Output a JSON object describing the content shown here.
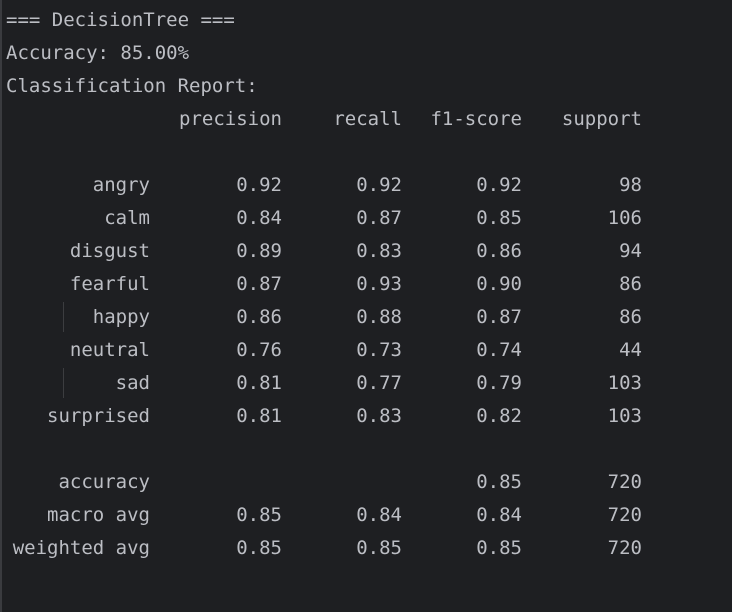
{
  "console": {
    "header": "=== DecisionTree ===",
    "accuracy_line": "Accuracy: 85.00%",
    "report_title": "Classification Report:"
  },
  "report": {
    "headers": [
      "precision",
      "recall",
      "f1-score",
      "support"
    ],
    "rows": [
      {
        "label": "angry",
        "precision": "0.92",
        "recall": "0.92",
        "f1": "0.92",
        "support": "98"
      },
      {
        "label": "calm",
        "precision": "0.84",
        "recall": "0.87",
        "f1": "0.85",
        "support": "106"
      },
      {
        "label": "disgust",
        "precision": "0.89",
        "recall": "0.83",
        "f1": "0.86",
        "support": "94"
      },
      {
        "label": "fearful",
        "precision": "0.87",
        "recall": "0.93",
        "f1": "0.90",
        "support": "86"
      },
      {
        "label": "happy",
        "precision": "0.86",
        "recall": "0.88",
        "f1": "0.87",
        "support": "86"
      },
      {
        "label": "neutral",
        "precision": "0.76",
        "recall": "0.73",
        "f1": "0.74",
        "support": "44"
      },
      {
        "label": "sad",
        "precision": "0.81",
        "recall": "0.77",
        "f1": "0.79",
        "support": "103"
      },
      {
        "label": "surprised",
        "precision": "0.81",
        "recall": "0.83",
        "f1": "0.82",
        "support": "103"
      }
    ],
    "summary": [
      {
        "label": "accuracy",
        "precision": "",
        "recall": "",
        "f1": "0.85",
        "support": "720"
      },
      {
        "label": "macro avg",
        "precision": "0.85",
        "recall": "0.84",
        "f1": "0.84",
        "support": "720"
      },
      {
        "label": "weighted avg",
        "precision": "0.85",
        "recall": "0.85",
        "f1": "0.85",
        "support": "720"
      }
    ]
  },
  "colors": {
    "background": "#1e1f22",
    "text": "#bcbec4"
  }
}
